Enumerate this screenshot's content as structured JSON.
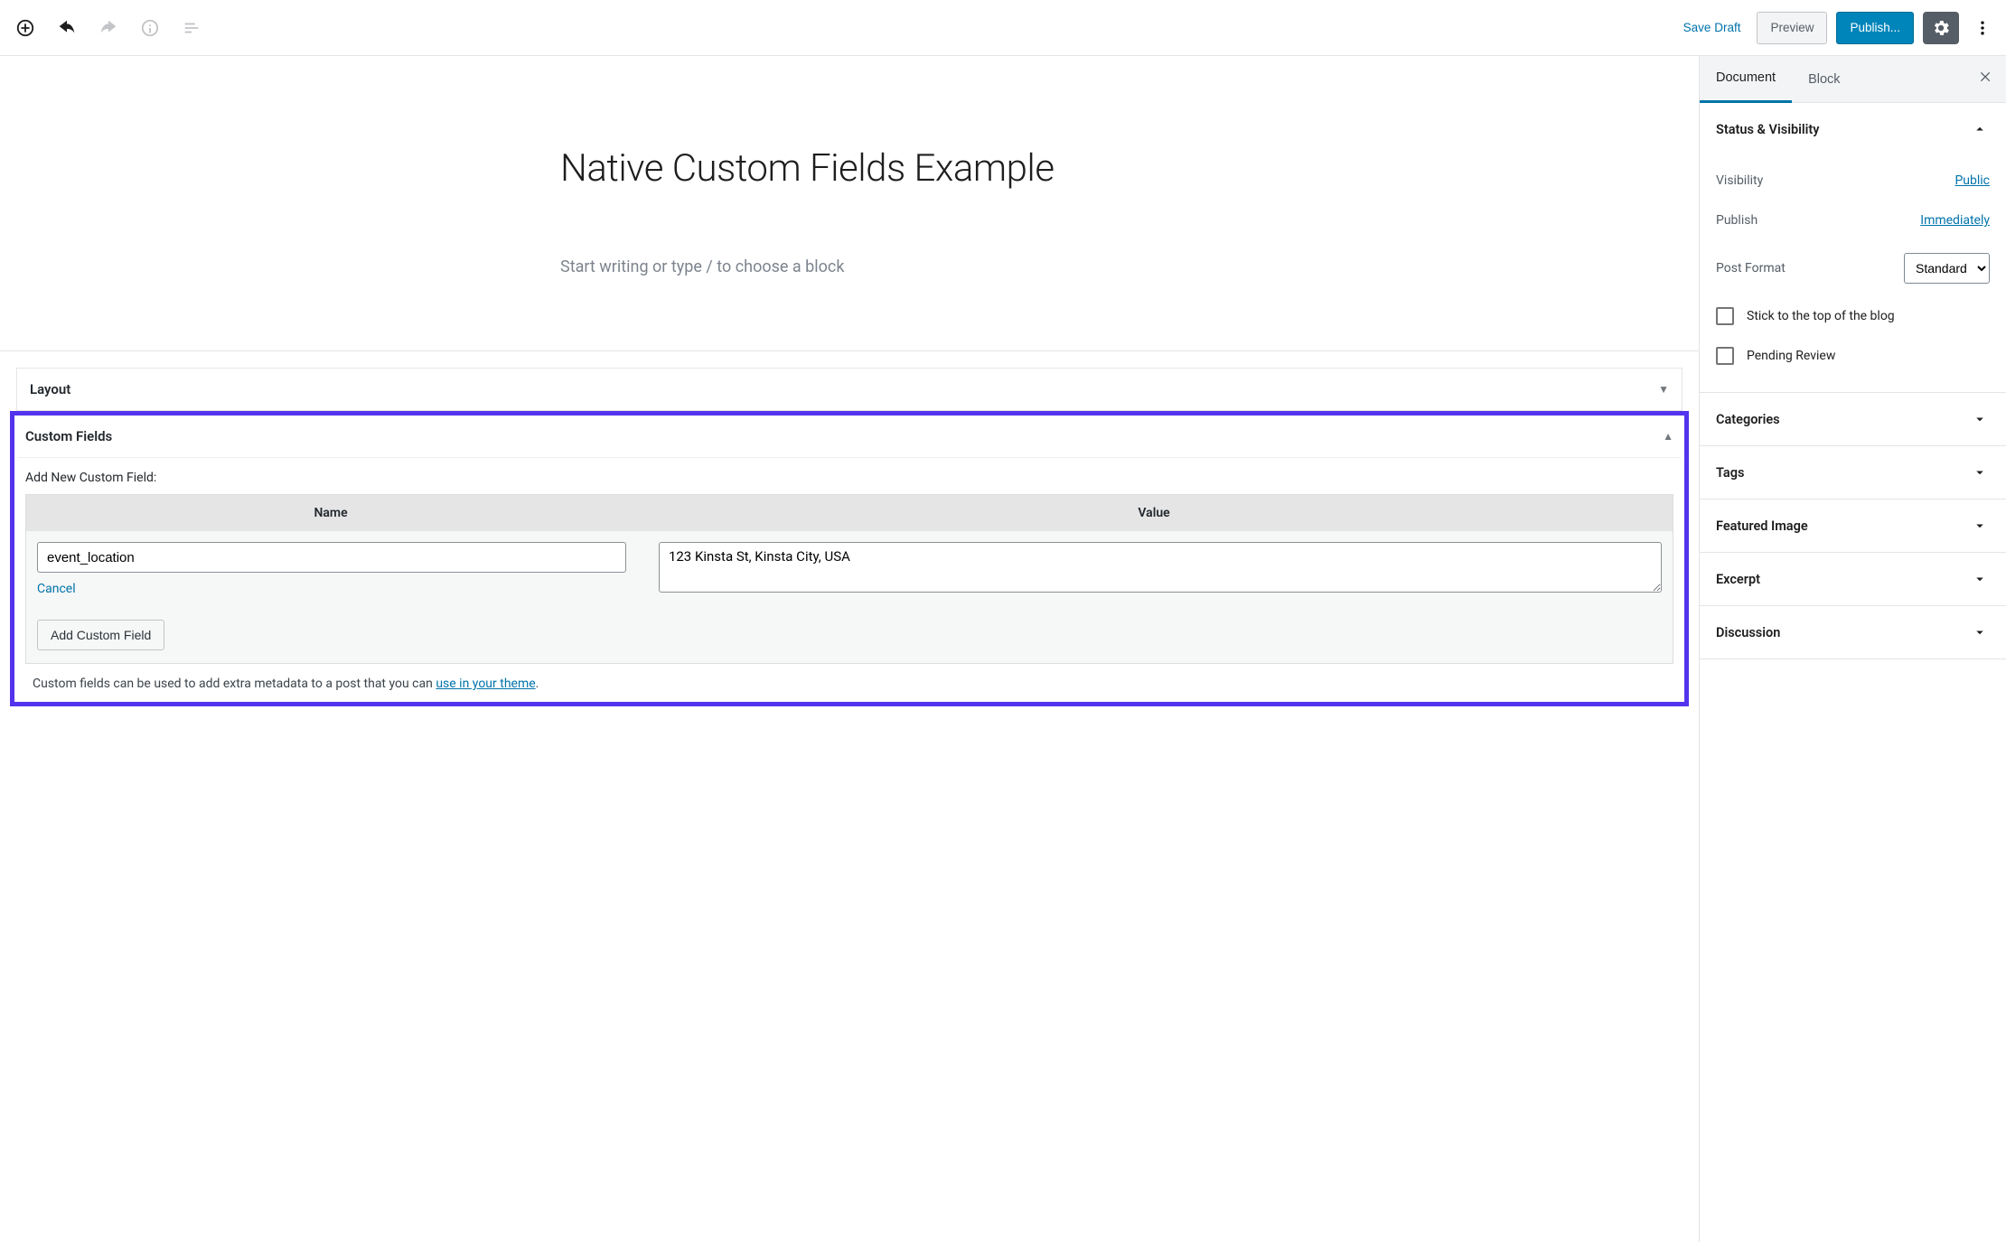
{
  "header": {
    "save_draft": "Save Draft",
    "preview": "Preview",
    "publish": "Publish..."
  },
  "editor": {
    "post_title": "Native Custom Fields Example",
    "block_placeholder": "Start writing or type / to choose a block"
  },
  "metaboxes": {
    "layout": {
      "title": "Layout"
    },
    "custom_fields": {
      "title": "Custom Fields",
      "add_label": "Add New Custom Field:",
      "columns": {
        "name": "Name",
        "value": "Value"
      },
      "name_value": "event_location",
      "value_value": "123 Kinsta St, Kinsta City, USA",
      "cancel": "Cancel",
      "add_button": "Add Custom Field",
      "help_prefix": "Custom fields can be used to add extra metadata to a post that you can ",
      "help_link": "use in your theme",
      "help_suffix": "."
    }
  },
  "sidebar": {
    "tabs": {
      "document": "Document",
      "block": "Block"
    },
    "status_visibility": {
      "title": "Status & Visibility",
      "visibility_label": "Visibility",
      "visibility_value": "Public",
      "publish_label": "Publish",
      "publish_value": "Immediately",
      "post_format_label": "Post Format",
      "post_format_value": "Standard",
      "stick_label": "Stick to the top of the blog",
      "pending_label": "Pending Review"
    },
    "panels": {
      "categories": "Categories",
      "tags": "Tags",
      "featured_image": "Featured Image",
      "excerpt": "Excerpt",
      "discussion": "Discussion"
    }
  }
}
